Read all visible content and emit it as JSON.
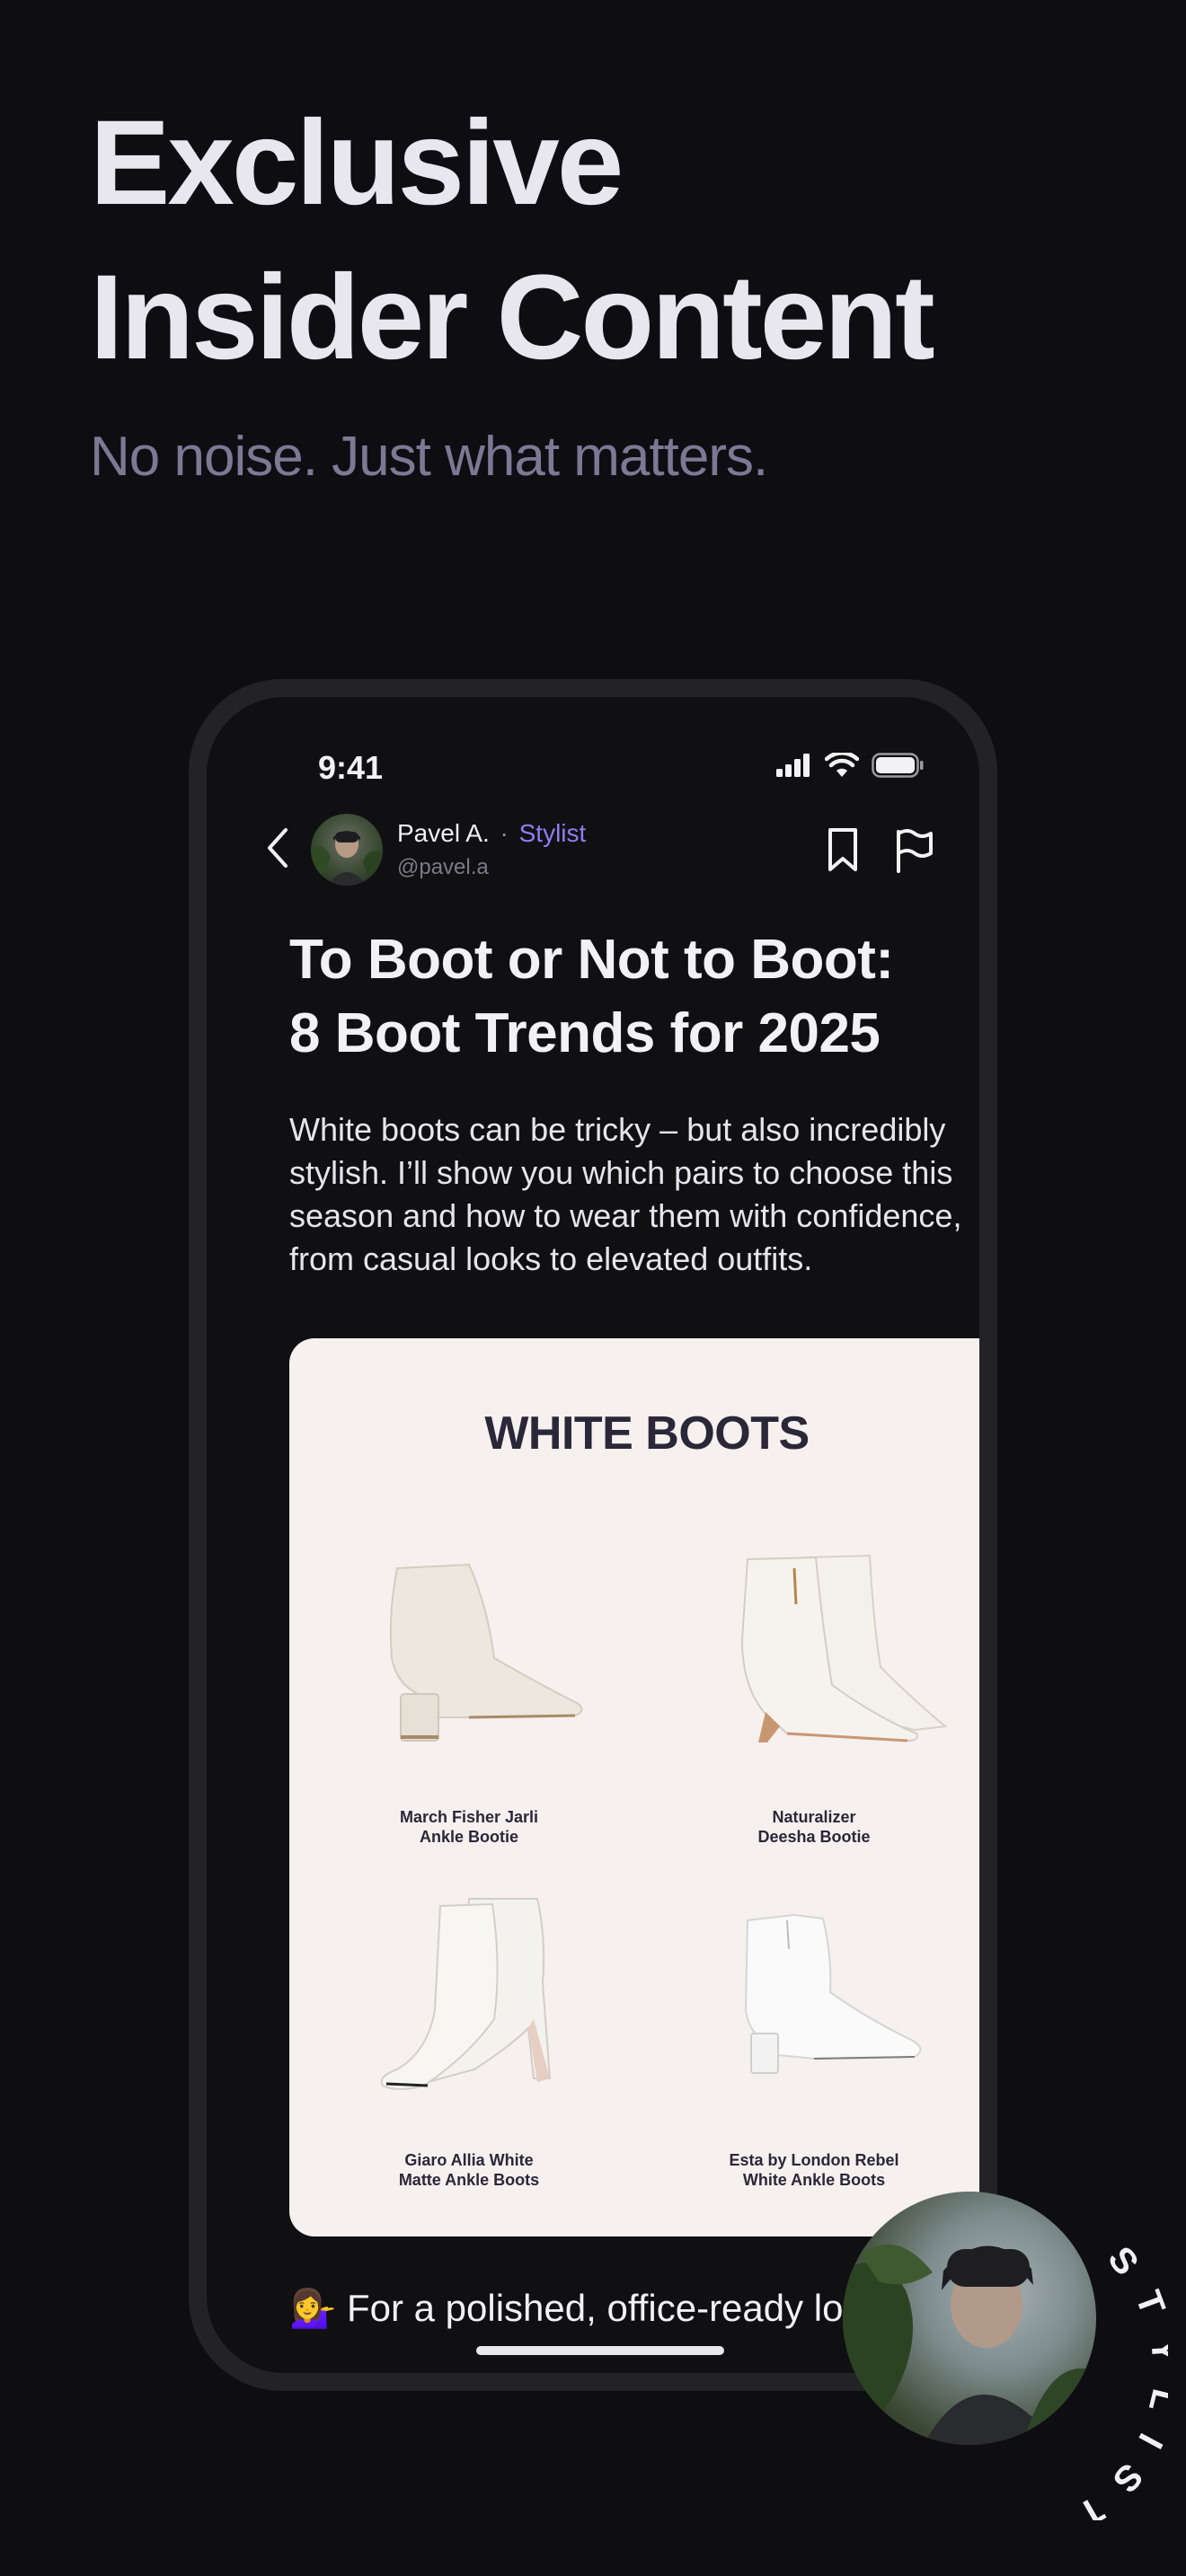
{
  "hero": {
    "title_line1": "Exclusive",
    "title_line2": "Insider Content",
    "subtitle": "No noise. Just what matters."
  },
  "status_bar": {
    "time": "9:41",
    "icons": [
      "cellular-signal-icon",
      "wifi-icon",
      "battery-icon"
    ]
  },
  "nav": {
    "back_icon": "chevron-left-icon",
    "author_name": "Pavel A.",
    "separator": "·",
    "author_role": "Stylist",
    "author_handle": "@pavel.a",
    "bookmark_icon": "bookmark-icon",
    "flag_icon": "flag-icon"
  },
  "article": {
    "title_line1": "To Boot or Not to Boot:",
    "title_line2": "8 Boot Trends for 2025",
    "body": "White boots can be tricky – but also incredibly stylish. I’ll show you which pairs to choose this season and how to wear them with confidence, from casual looks to elevated outfits."
  },
  "card": {
    "title": "WHITE BOOTS",
    "items": [
      {
        "line1": "March Fisher Jarli",
        "line2": "Ankle Bootie"
      },
      {
        "line1": "Naturalizer",
        "line2": "Deesha Bootie"
      },
      {
        "line1": "Giaro Allia White",
        "line2": "Matte Ankle Boots"
      },
      {
        "line1": "Esta by London Rebel",
        "line2": "White Ankle Boots"
      }
    ]
  },
  "footer": {
    "emoji": "💁‍♀️",
    "text": "For a polished, office-ready look:"
  },
  "badge": {
    "label": "STYLIST"
  },
  "colors": {
    "background": "#0e0e12",
    "accent": "#8f7ef0",
    "subtitle": "#7d7894",
    "card": "#f6f0ef"
  }
}
